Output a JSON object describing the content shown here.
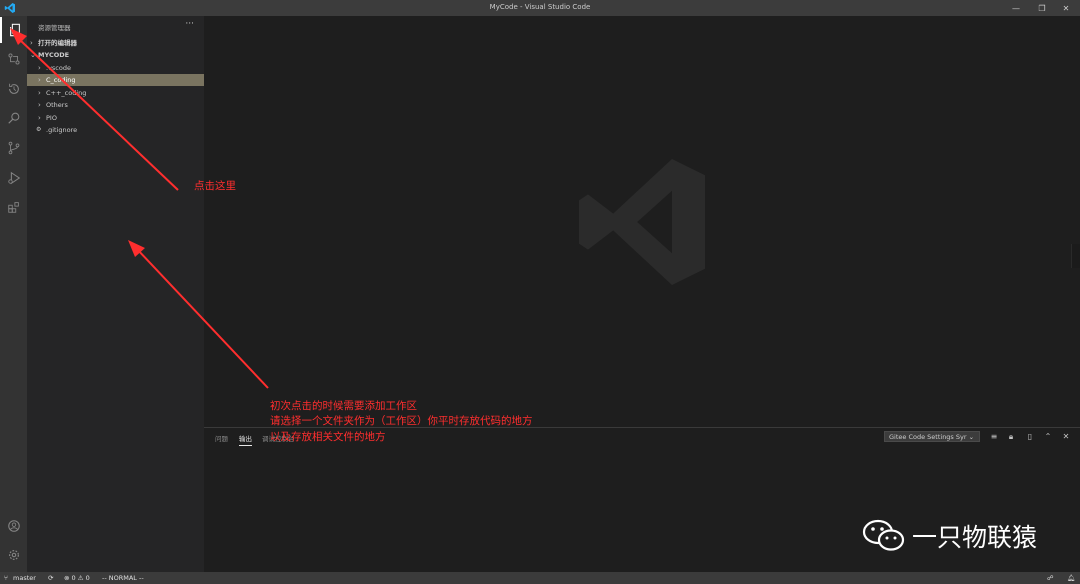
{
  "window": {
    "title": "MyCode - Visual Studio Code"
  },
  "explorer": {
    "header": "资源管理器",
    "more": "···",
    "open_editors": "打开的编辑器",
    "workspace": "MYCODE",
    "items": [
      {
        "label": ".vscode",
        "chevron": "›"
      },
      {
        "label": "C_coding",
        "chevron": "›"
      },
      {
        "label": "C++_coding",
        "chevron": "›"
      },
      {
        "label": "Others",
        "chevron": "›"
      },
      {
        "label": "PIO",
        "chevron": "›"
      },
      {
        "label": ".gitignore",
        "chevron": "⚙"
      }
    ]
  },
  "panel": {
    "tabs": [
      "问题",
      "输出",
      "调试控制台"
    ],
    "select": "Gitee Code Settings Syr ⌄"
  },
  "statusbar": {
    "branch": "master",
    "errors": "⊗ 0 ⚠ 0",
    "mode": "-- NORMAL --"
  },
  "annotations": {
    "click_here": "点击这里",
    "note_lines": [
      "初次点击的时候需要添加工作区",
      "请选择一个文件夹作为（工作区）你平时存放代码的地方",
      "以及存放相关文件的地方"
    ]
  },
  "watermark": "一只物联猿",
  "colors": {
    "annotation": "#ff2e2e",
    "vscode_blue": "#23a9f2"
  }
}
